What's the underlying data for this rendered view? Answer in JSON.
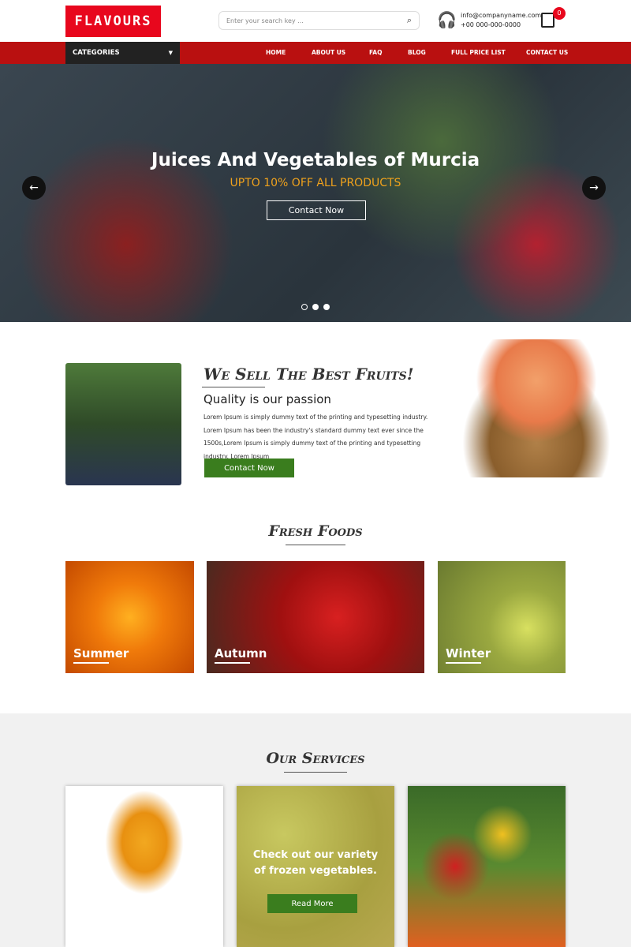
{
  "header": {
    "logo": "FLAVOURS",
    "search_placeholder": "Enter your search key ...",
    "email": "info@companyname.com",
    "phone": "+00 000-000-0000",
    "cart_count": "0"
  },
  "nav": {
    "categories": "CATEGORIES",
    "items": [
      "HOME",
      "ABOUT US",
      "FAQ",
      "BLOG",
      "FULL PRICE LIST",
      "CONTACT US"
    ]
  },
  "hero": {
    "title": "Juices And Vegetables of Murcia",
    "subtitle": "UPTO 10% OFF ALL PRODUCTS",
    "button": "Contact Now",
    "slides": 3,
    "active_slide": 1
  },
  "about": {
    "heading": "We Sell The Best Fruits!",
    "subheading": "Quality is our passion",
    "body": "Lorem Ipsum is simply dummy text of the printing and typesetting industry. Lorem Ipsum has been the industry's standard dummy text ever since the 1500s,Lorem Ipsum is simply dummy text of the printing and typesetting industry. Lorem Ipsum",
    "button": "Contact Now"
  },
  "fresh": {
    "heading": "Fresh Foods",
    "tiles": [
      "Summer",
      "Autumn",
      "Winter"
    ]
  },
  "services": {
    "heading": "Our Services",
    "card_text": "Check out our variety of frozen vegetables.",
    "card_button": "Read More"
  }
}
